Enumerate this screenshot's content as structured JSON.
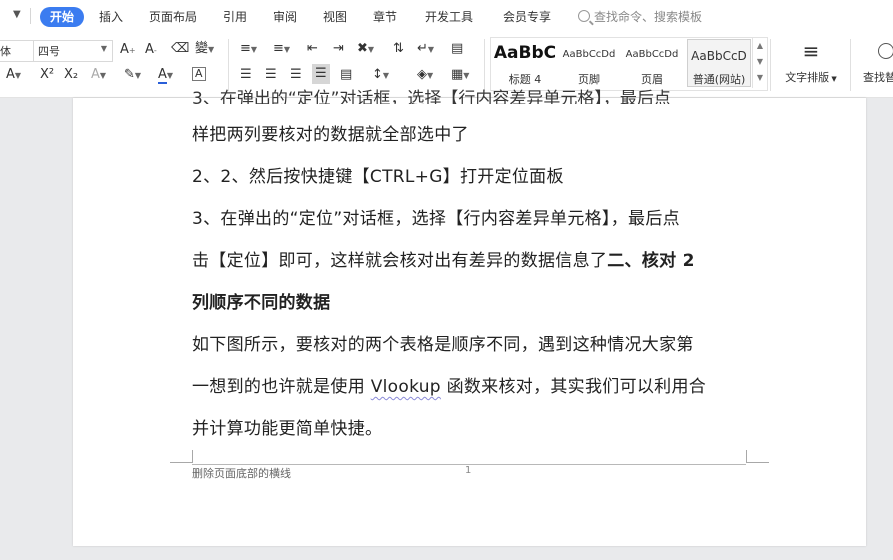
{
  "menu": {
    "tabs": [
      "开始",
      "插入",
      "页面布局",
      "引用",
      "审阅",
      "视图",
      "章节",
      "开发工具",
      "会员专享"
    ],
    "active_tab": "开始",
    "search_placeholder": "查找命令、搜索模板"
  },
  "ribbon": {
    "font_name": "体",
    "font_size": "四号",
    "styles": [
      {
        "preview": "AaBbC",
        "label": "标题 4"
      },
      {
        "preview": "AaBbCcDd",
        "label": "页脚"
      },
      {
        "preview": "AaBbCcDd",
        "label": "页眉"
      },
      {
        "preview": "AaBbCcD",
        "label": "普通(网站)"
      }
    ],
    "text_layout_label": "文字排版",
    "find_replace_label": "查找替"
  },
  "document": {
    "cut_line": "3、在弹出的“定位”对话框，选择【行内容差异单元格】，最后点",
    "lines": [
      "样把两列要核对的数据就全部选中了",
      "2、2、然后按快捷键【CTRL+G】打开定位面板",
      "3、在弹出的“定位”对话框，选择【行内容差异单元格】，最后点"
    ],
    "line4_normal": "击【定位】即可，这样就会核对出有差异的数据信息了",
    "line4_bold": "二、核对 2",
    "line5_bold": "列顺序不同的数据",
    "line6": "如下图所示，要核对的两个表格是顺序不同，遇到这种情况大家第",
    "line7_a": "一想到的也许就是使用 ",
    "line7_word": "Vlookup",
    "line7_b": " 函数来核对，其实我们可以利用合",
    "line8": "并计算功能更简单快捷。",
    "footer_text": "删除页面底部的横线",
    "page_number": "1"
  }
}
